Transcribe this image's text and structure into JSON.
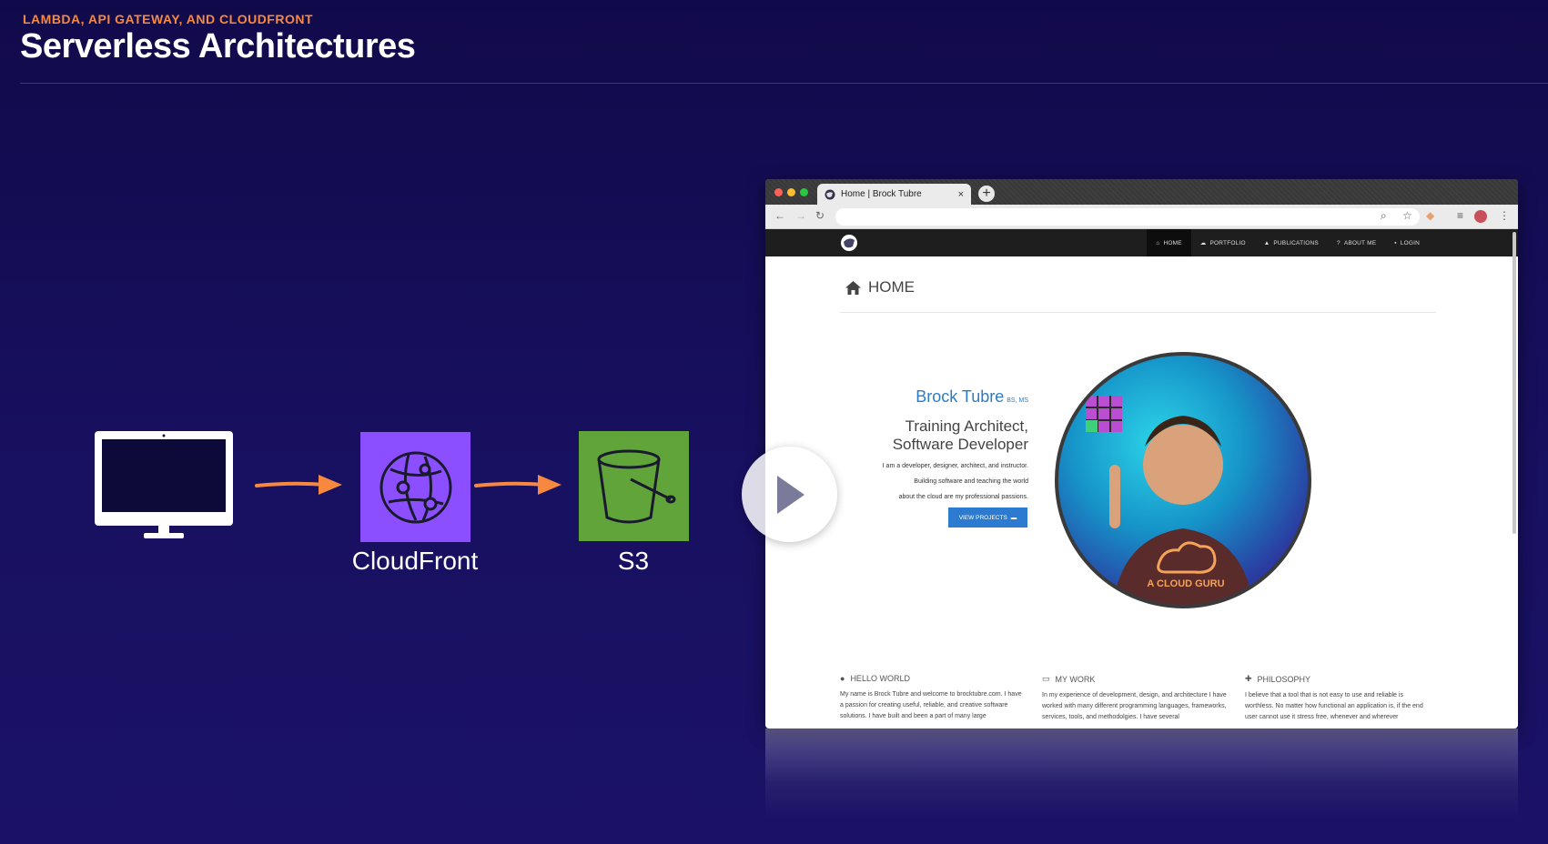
{
  "slide": {
    "eyebrow": "LAMBDA, API GATEWAY, AND CLOUDFRONT",
    "title": "Serverless Architectures",
    "accent_color": "#f6893f"
  },
  "diagram": {
    "client_icon": "desktop-monitor-icon",
    "services": [
      {
        "label": "CloudFront",
        "icon": "cloudfront-icon",
        "color": "#8c4fff"
      },
      {
        "label": "S3",
        "icon": "s3-bucket-icon",
        "color": "#60a43a"
      }
    ]
  },
  "browser": {
    "tab_title": "Home | Brock Tubre",
    "tab_close": "×",
    "new_tab": "+",
    "site_nav": [
      {
        "label": "HOME",
        "icon": "home-icon",
        "active": true
      },
      {
        "label": "PORTFOLIO",
        "icon": "portfolio-icon",
        "active": false
      },
      {
        "label": "PUBLICATIONS",
        "icon": "graduation-cap-icon",
        "active": false
      },
      {
        "label": "ABOUT ME",
        "icon": "question-icon",
        "active": false
      },
      {
        "label": "LOGIN",
        "icon": "lock-icon",
        "active": false
      }
    ],
    "page": {
      "heading": "HOME",
      "name": "Brock Tubre",
      "credentials": "BS, MS",
      "role_line1": "Training Architect,",
      "role_line2": "Software Developer",
      "blurb_line1": "I am a developer, designer, architect, and instructor.",
      "blurb_line2": "Building software and teaching the world",
      "blurb_line3": "about the cloud are my professional passions.",
      "button": "VIEW PROJECTS",
      "avatar_shirt_text": "A CLOUD GURU",
      "columns": [
        {
          "title": "HELLO WORLD",
          "icon": "globe-icon",
          "text": "My name is Brock Tubre and welcome to brocktubre.com. I have a passion for creating useful, reliable, and creative software solutions. I have built and been a part of many large"
        },
        {
          "title": "MY WORK",
          "icon": "monitor-icon",
          "text": "In my experience of development, design, and architecture I have worked with many different programming languages, frameworks, services, tools, and methodolgies. I have several"
        },
        {
          "title": "PHILOSOPHY",
          "icon": "puzzle-icon",
          "text": "I believe that a tool that is not easy to use and reliable is worthless. No matter how functional an application is, if the end user cannot use it stress free, whenever and wherever"
        }
      ]
    }
  },
  "video": {
    "play_icon": "play-icon"
  }
}
